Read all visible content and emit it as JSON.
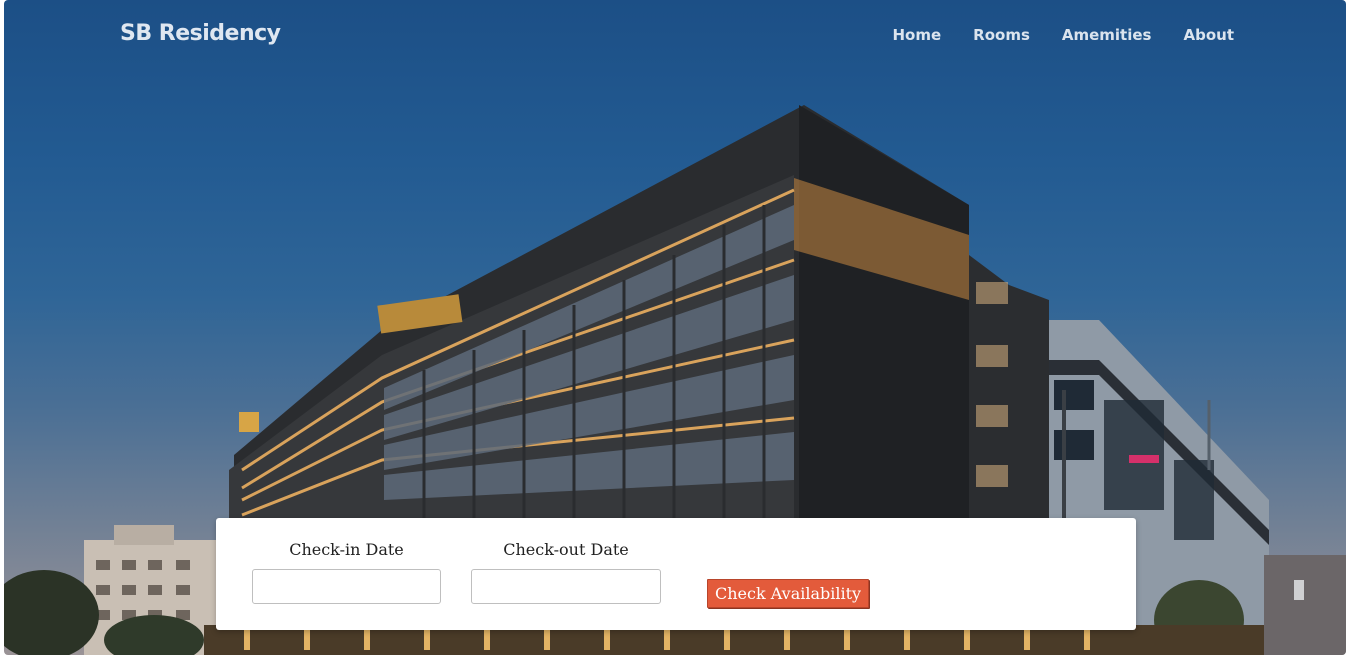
{
  "header": {
    "brand": "SB Residency",
    "nav": [
      "Home",
      "Rooms",
      "Amemities",
      "About"
    ]
  },
  "booking": {
    "checkin_label": "Check-in Date",
    "checkin_value": "",
    "checkout_label": "Check-out Date",
    "checkout_value": "",
    "button_label": "Check Availability"
  },
  "colors": {
    "sky": "#235b92",
    "accent": "#e35b3b",
    "nav_text": "#dbe4ee"
  }
}
